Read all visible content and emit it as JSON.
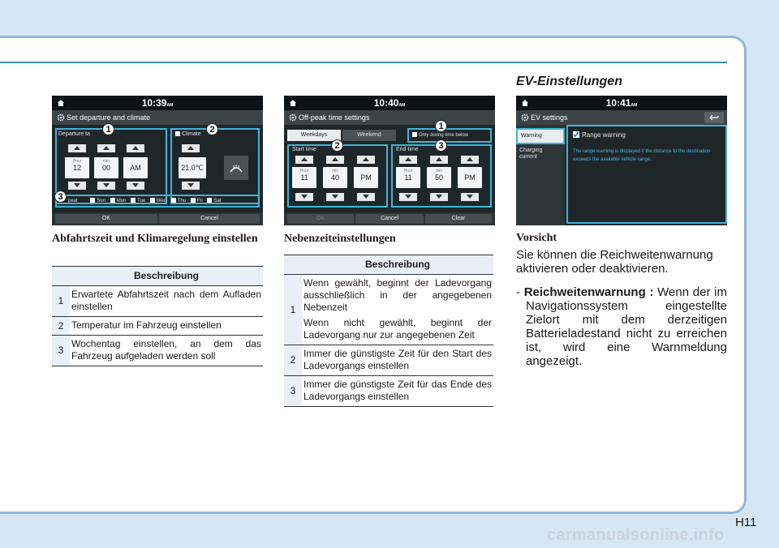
{
  "section_title": "EV-Einstellungen",
  "page_number": "H11",
  "watermark": "carmanualsonline.info",
  "screen1": {
    "clock": "10:39",
    "clock_suffix": "AM",
    "title": "Set departure and climate",
    "departure_label": "Departure ta",
    "climate_label": "Climate",
    "hour_label": "Hour",
    "hour_value": "12",
    "min_label": "min",
    "min_value": "00",
    "ampm_value": "AM",
    "temp_value": "21.0℃",
    "repeat_label": "peat",
    "days": [
      "Sun",
      "Mon",
      "Tue",
      "Wed",
      "Thu",
      "Fri",
      "Sat"
    ],
    "ok_label": "OK",
    "cancel_label": "Cancel",
    "badges": [
      "1",
      "2",
      "3"
    ]
  },
  "screen2": {
    "clock": "10:40",
    "clock_suffix": "AM",
    "title": "Off-peak time settings",
    "tab_weekdays": "Weekdays",
    "tab_weekend": "Weekend",
    "only_during": "Only during time below",
    "start_label": "Start time",
    "end_label": "End time",
    "hour_label": "Hour",
    "min_label": "min",
    "start_hour": "11",
    "start_min": "40",
    "start_ampm": "PM",
    "end_hour": "11",
    "end_min": "50",
    "end_ampm": "PM",
    "ok_label": "OK",
    "cancel_label": "Cancel",
    "clear_label": "Clear",
    "badges": [
      "1",
      "2",
      "3"
    ]
  },
  "screen3": {
    "clock": "10:41",
    "clock_suffix": "AM",
    "title": "EV settings",
    "menu_warning": "Warning",
    "menu_charging": "Charging current",
    "range_warning": "Range warning",
    "description": "The range warning is displayed if the distance to the destination exceeds the available vehicle range."
  },
  "caption1": "Abfahrtszeit und Klimaregelung einstellen",
  "caption2": "Nebenzeiteinstellungen",
  "table1": {
    "header": "Beschreibung",
    "rows": [
      {
        "num": "1",
        "text": "Erwartete Abfahrtszeit nach dem Aufladen einstellen"
      },
      {
        "num": "2",
        "text": "Temperatur im Fahrzeug einstellen"
      },
      {
        "num": "3",
        "text": "Wochentag einstellen, an dem das Fahrzeug aufgeladen werden soll"
      }
    ]
  },
  "table2": {
    "header": "Beschreibung",
    "rows": [
      {
        "num": "1",
        "text_a": "Wenn gewählt, beginnt der Ladevorgang ausschließlich in der angegebenen Nebenzeit",
        "text_b": "Wenn nicht gewählt, beginnt der Ladevorgang nur zur angegebenen Zeit"
      },
      {
        "num": "2",
        "text": "Immer die günstigste Zeit für den Start des Ladevorgangs einstellen"
      },
      {
        "num": "3",
        "text": "Immer die günstigste Zeit für das Ende des Ladevorgangs einstellen"
      }
    ]
  },
  "vorsicht": {
    "title": "Vorsicht",
    "intro": "Sie können die Reichweitenwarnung aktivieren oder deaktivieren.",
    "item_prefix": "- ",
    "item_term": "Reichweitenwarnung :",
    "item_text": " Wenn der im Navigationssystem eingestellte Zielort mit dem derzeitigen Batterieladestand nicht zu erreichen ist, wird eine Warnmeldung angezeigt."
  }
}
